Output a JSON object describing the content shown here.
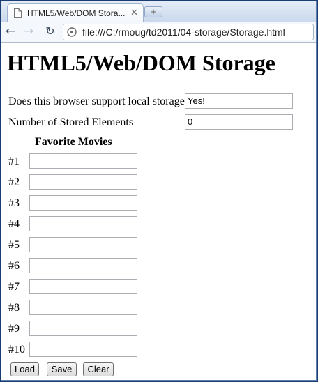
{
  "browser": {
    "tab_title": "HTML5/Web/DOM Stora...",
    "tab_close": "✕",
    "new_tab": "+",
    "url": "file:///C:/rmoug/td2011/04-storage/Storage.html"
  },
  "page": {
    "heading": "HTML5/Web/DOM Storage",
    "support_label": "Does this browser support local storage?",
    "support_value": "Yes!",
    "count_label": "Number of Stored Elements",
    "count_value": "0",
    "movies_heading": "Favorite Movies",
    "movie_rows": [
      "#1",
      "#2",
      "#3",
      "#4",
      "#5",
      "#6",
      "#7",
      "#8",
      "#9",
      "#10"
    ],
    "buttons": {
      "load": "Load",
      "save": "Save",
      "clear": "Clear"
    }
  }
}
